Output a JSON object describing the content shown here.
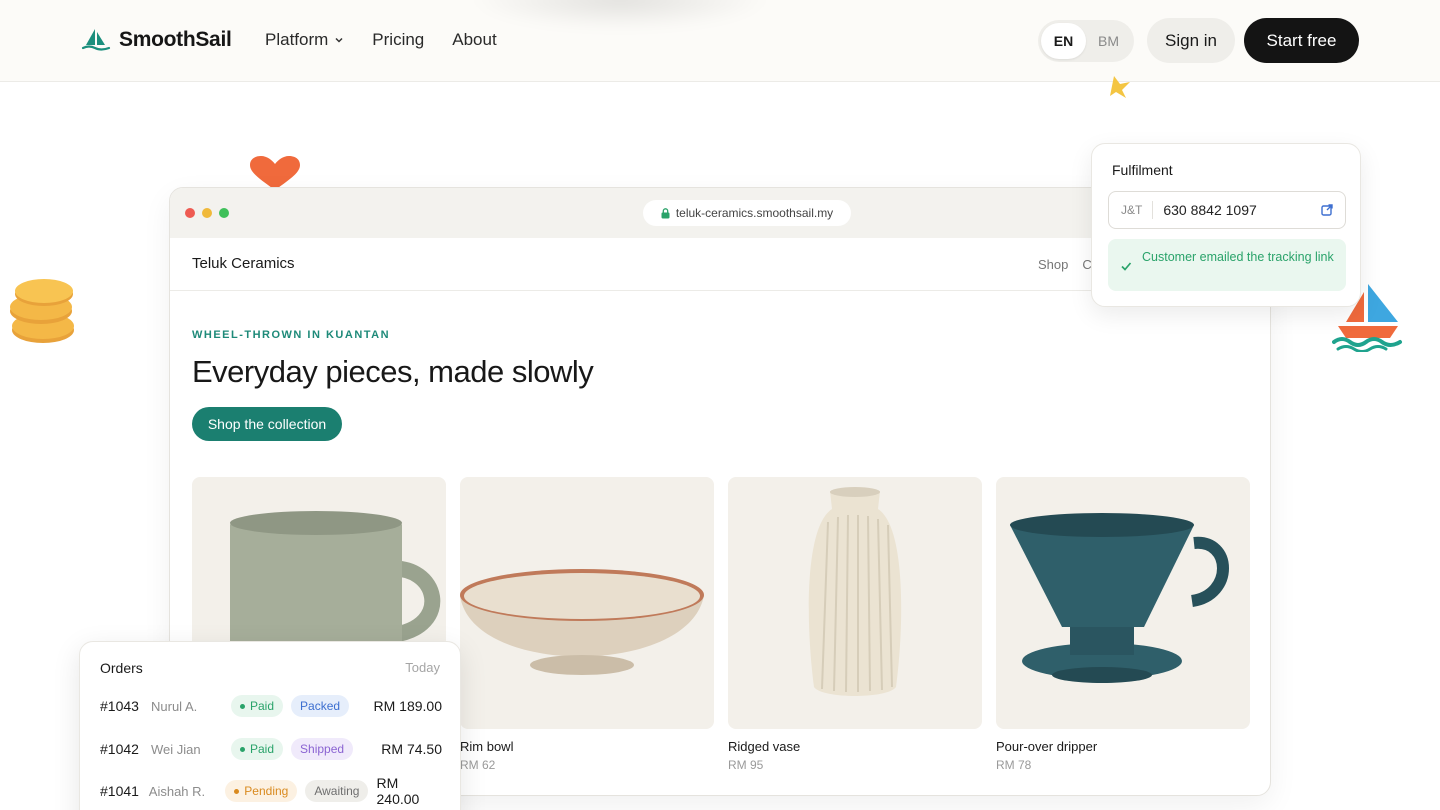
{
  "nav": {
    "brand": "SmoothSail",
    "links": [
      {
        "label": "Platform",
        "has_dropdown": true
      },
      {
        "label": "Pricing"
      },
      {
        "label": "About"
      }
    ],
    "languages": [
      "EN",
      "BM"
    ],
    "active_language": "EN",
    "sign_in": "Sign in",
    "start_free": "Start free"
  },
  "browser": {
    "url": "teluk-ceramics.smoothsail.my",
    "store_name": "Teluk Ceramics",
    "store_menu": [
      "Shop",
      "C"
    ],
    "eyebrow": "WHEEL-THROWN IN KUANTAN",
    "headline": "Everyday pieces, made slowly",
    "cta": "Shop the collection",
    "products": [
      {
        "name": "",
        "price": "",
        "icon": "mug"
      },
      {
        "name": "Rim bowl",
        "price": "RM 62",
        "icon": "bowl"
      },
      {
        "name": "Ridged vase",
        "price": "RM 95",
        "icon": "vase"
      },
      {
        "name": "Pour-over dripper",
        "price": "RM 78",
        "icon": "dripper"
      }
    ]
  },
  "fulfilment": {
    "title": "Fulfilment",
    "carrier": "J&T",
    "tracking_number": "630 8842 1097",
    "note": "Customer emailed the tracking link"
  },
  "orders": {
    "title": "Orders",
    "date": "Today",
    "rows": [
      {
        "id": "#1043",
        "customer": "Nurul A.",
        "payment": "Paid",
        "status": "Packed",
        "total": "RM 189.00"
      },
      {
        "id": "#1042",
        "customer": "Wei Jian",
        "payment": "Paid",
        "status": "Shipped",
        "total": "RM 74.50"
      },
      {
        "id": "#1041",
        "customer": "Aishah R.",
        "payment": "Pending",
        "status": "Awaiting",
        "total": "RM 240.00"
      }
    ]
  },
  "colors": {
    "accent_teal": "#1b7f70",
    "paid_green": "#2aa36a",
    "packed_blue": "#3d6fd0",
    "shipped_purple": "#8a63d2",
    "pending_orange": "#d98a1f"
  }
}
